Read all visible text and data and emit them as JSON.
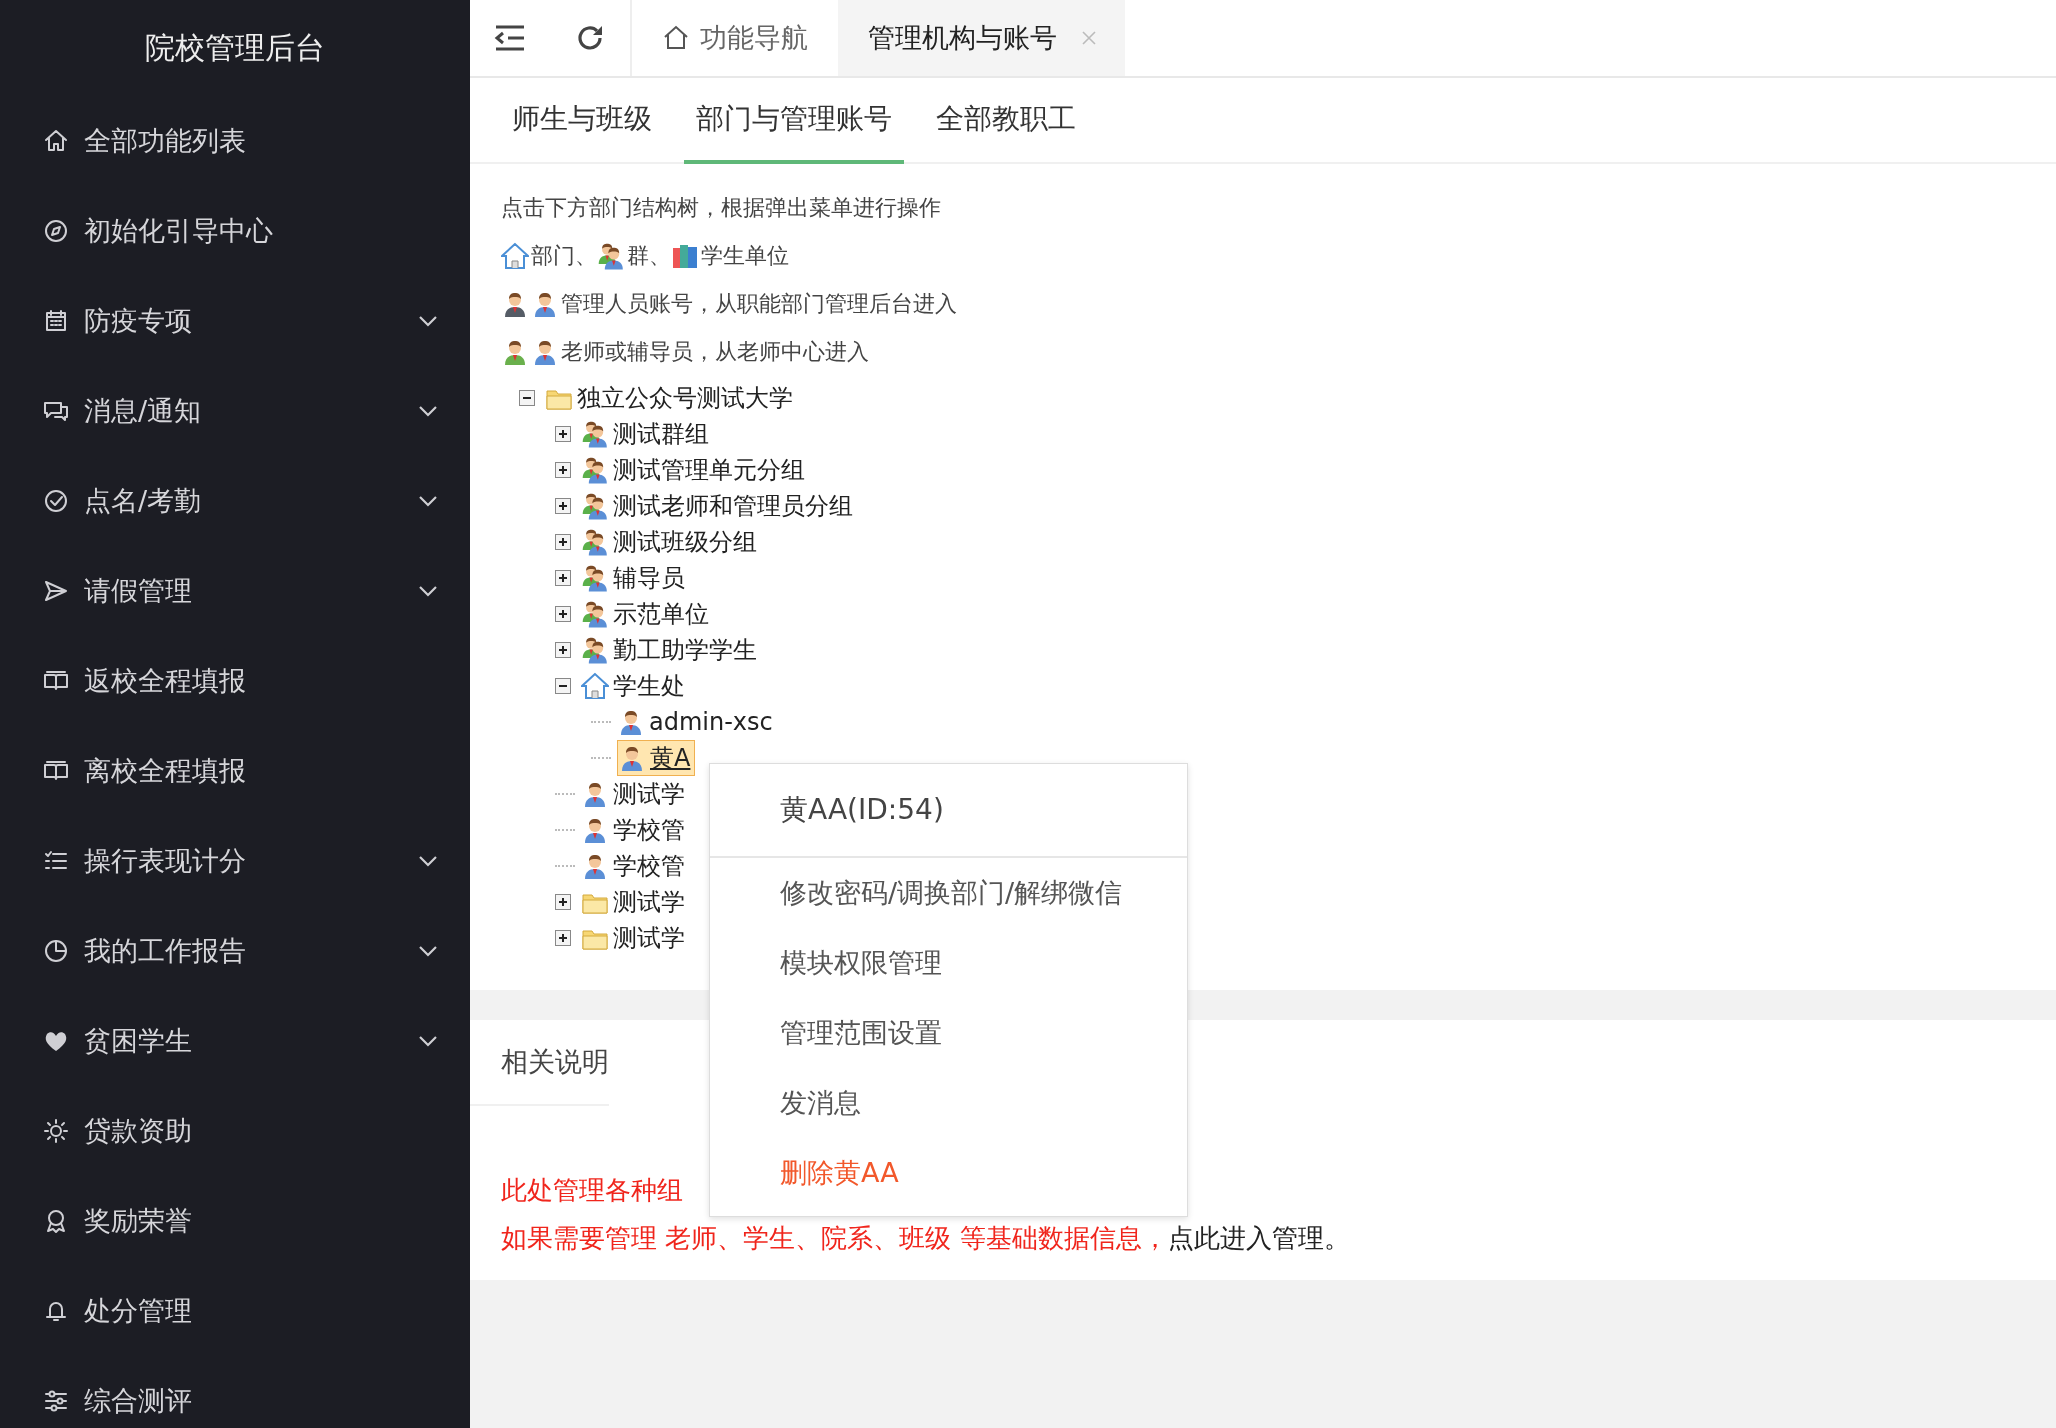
{
  "sidebar": {
    "title": "院校管理后台",
    "items": [
      {
        "label": "全部功能列表",
        "expandable": false
      },
      {
        "label": "初始化引导中心",
        "expandable": false
      },
      {
        "label": "防疫专项",
        "expandable": true
      },
      {
        "label": "消息/通知",
        "expandable": true
      },
      {
        "label": "点名/考勤",
        "expandable": true
      },
      {
        "label": "请假管理",
        "expandable": true
      },
      {
        "label": "返校全程填报",
        "expandable": false
      },
      {
        "label": "离校全程填报",
        "expandable": false
      },
      {
        "label": "操行表现计分",
        "expandable": true
      },
      {
        "label": "我的工作报告",
        "expandable": true
      },
      {
        "label": "贫困学生",
        "expandable": true
      },
      {
        "label": "贷款资助",
        "expandable": false
      },
      {
        "label": "奖励荣誉",
        "expandable": false
      },
      {
        "label": "处分管理",
        "expandable": false
      },
      {
        "label": "综合测评",
        "expandable": false
      }
    ]
  },
  "tabs": [
    {
      "label": "功能导航",
      "selected": false,
      "closable": false
    },
    {
      "label": "管理机构与账号",
      "selected": true,
      "closable": true
    }
  ],
  "sub_tabs": [
    {
      "label": "师生与班级",
      "selected": false
    },
    {
      "label": "部门与管理账号",
      "selected": true
    },
    {
      "label": "全部教职工",
      "selected": false
    }
  ],
  "intro": "点击下方部门结构树，根据弹出菜单进行操作",
  "legend": [
    {
      "items": [
        {
          "kind": "dept",
          "text": "部门、"
        },
        {
          "kind": "group",
          "text": "群、"
        },
        {
          "kind": "unit",
          "text": "学生单位"
        }
      ]
    },
    {
      "items": [
        {
          "kind": "manager"
        },
        {
          "kind": "user",
          "text": "管理人员账号，从职能部门管理后台进入"
        }
      ]
    },
    {
      "items": [
        {
          "kind": "teacher"
        },
        {
          "kind": "user",
          "text": "老师或辅导员，从老师中心进入"
        }
      ]
    }
  ],
  "tree": [
    {
      "label": "独立公众号测试大学",
      "kind": "folder",
      "expanded": true,
      "selected": false,
      "children": [
        {
          "label": "测试群组",
          "kind": "group",
          "expanded": false,
          "selected": false
        },
        {
          "label": "测试管理单元分组",
          "kind": "group",
          "expanded": false,
          "selected": false
        },
        {
          "label": "测试老师和管理员分组",
          "kind": "group",
          "expanded": false,
          "selected": false
        },
        {
          "label": "测试班级分组",
          "kind": "group",
          "expanded": false,
          "selected": false
        },
        {
          "label": "辅导员",
          "kind": "group",
          "expanded": false,
          "selected": false
        },
        {
          "label": "示范单位",
          "kind": "group",
          "expanded": false,
          "selected": false
        },
        {
          "label": "勤工助学学生",
          "kind": "group",
          "expanded": false,
          "selected": false
        },
        {
          "label": "学生处",
          "kind": "dept",
          "expanded": true,
          "selected": false,
          "children": [
            {
              "label": "admin-xsc",
              "kind": "user",
              "selected": false
            },
            {
              "label": "黄A",
              "kind": "user",
              "selected": true
            }
          ]
        },
        {
          "label": "测试学",
          "kind": "user",
          "selected": false
        },
        {
          "label": "学校管",
          "kind": "user",
          "selected": false
        },
        {
          "label": "学校管",
          "kind": "user",
          "selected": false
        },
        {
          "label": "测试学",
          "kind": "folder",
          "expanded": false,
          "selected": false
        },
        {
          "label": "测试学",
          "kind": "folder",
          "expanded": false,
          "selected": false
        }
      ]
    }
  ],
  "notes": {
    "title": "相关说明",
    "lines": [
      [
        {
          "kind": "warning",
          "text": "此处管理各种组"
        }
      ],
      [
        {
          "kind": "warning",
          "text": "如果需要管理 老师、学生、院系、班级 等基础数据信息，"
        },
        {
          "kind": "link",
          "text": "点此进入管理。"
        }
      ]
    ]
  },
  "context_menu": {
    "header": "黄AA(ID:54)",
    "items": [
      {
        "label": "修改密码/调换部门/解绑微信",
        "kind": "normal"
      },
      {
        "label": "模块权限管理",
        "kind": "normal"
      },
      {
        "label": "管理范围设置",
        "kind": "normal"
      },
      {
        "label": "发消息",
        "kind": "normal"
      },
      {
        "label": "删除黄AA",
        "kind": "danger"
      }
    ]
  }
}
